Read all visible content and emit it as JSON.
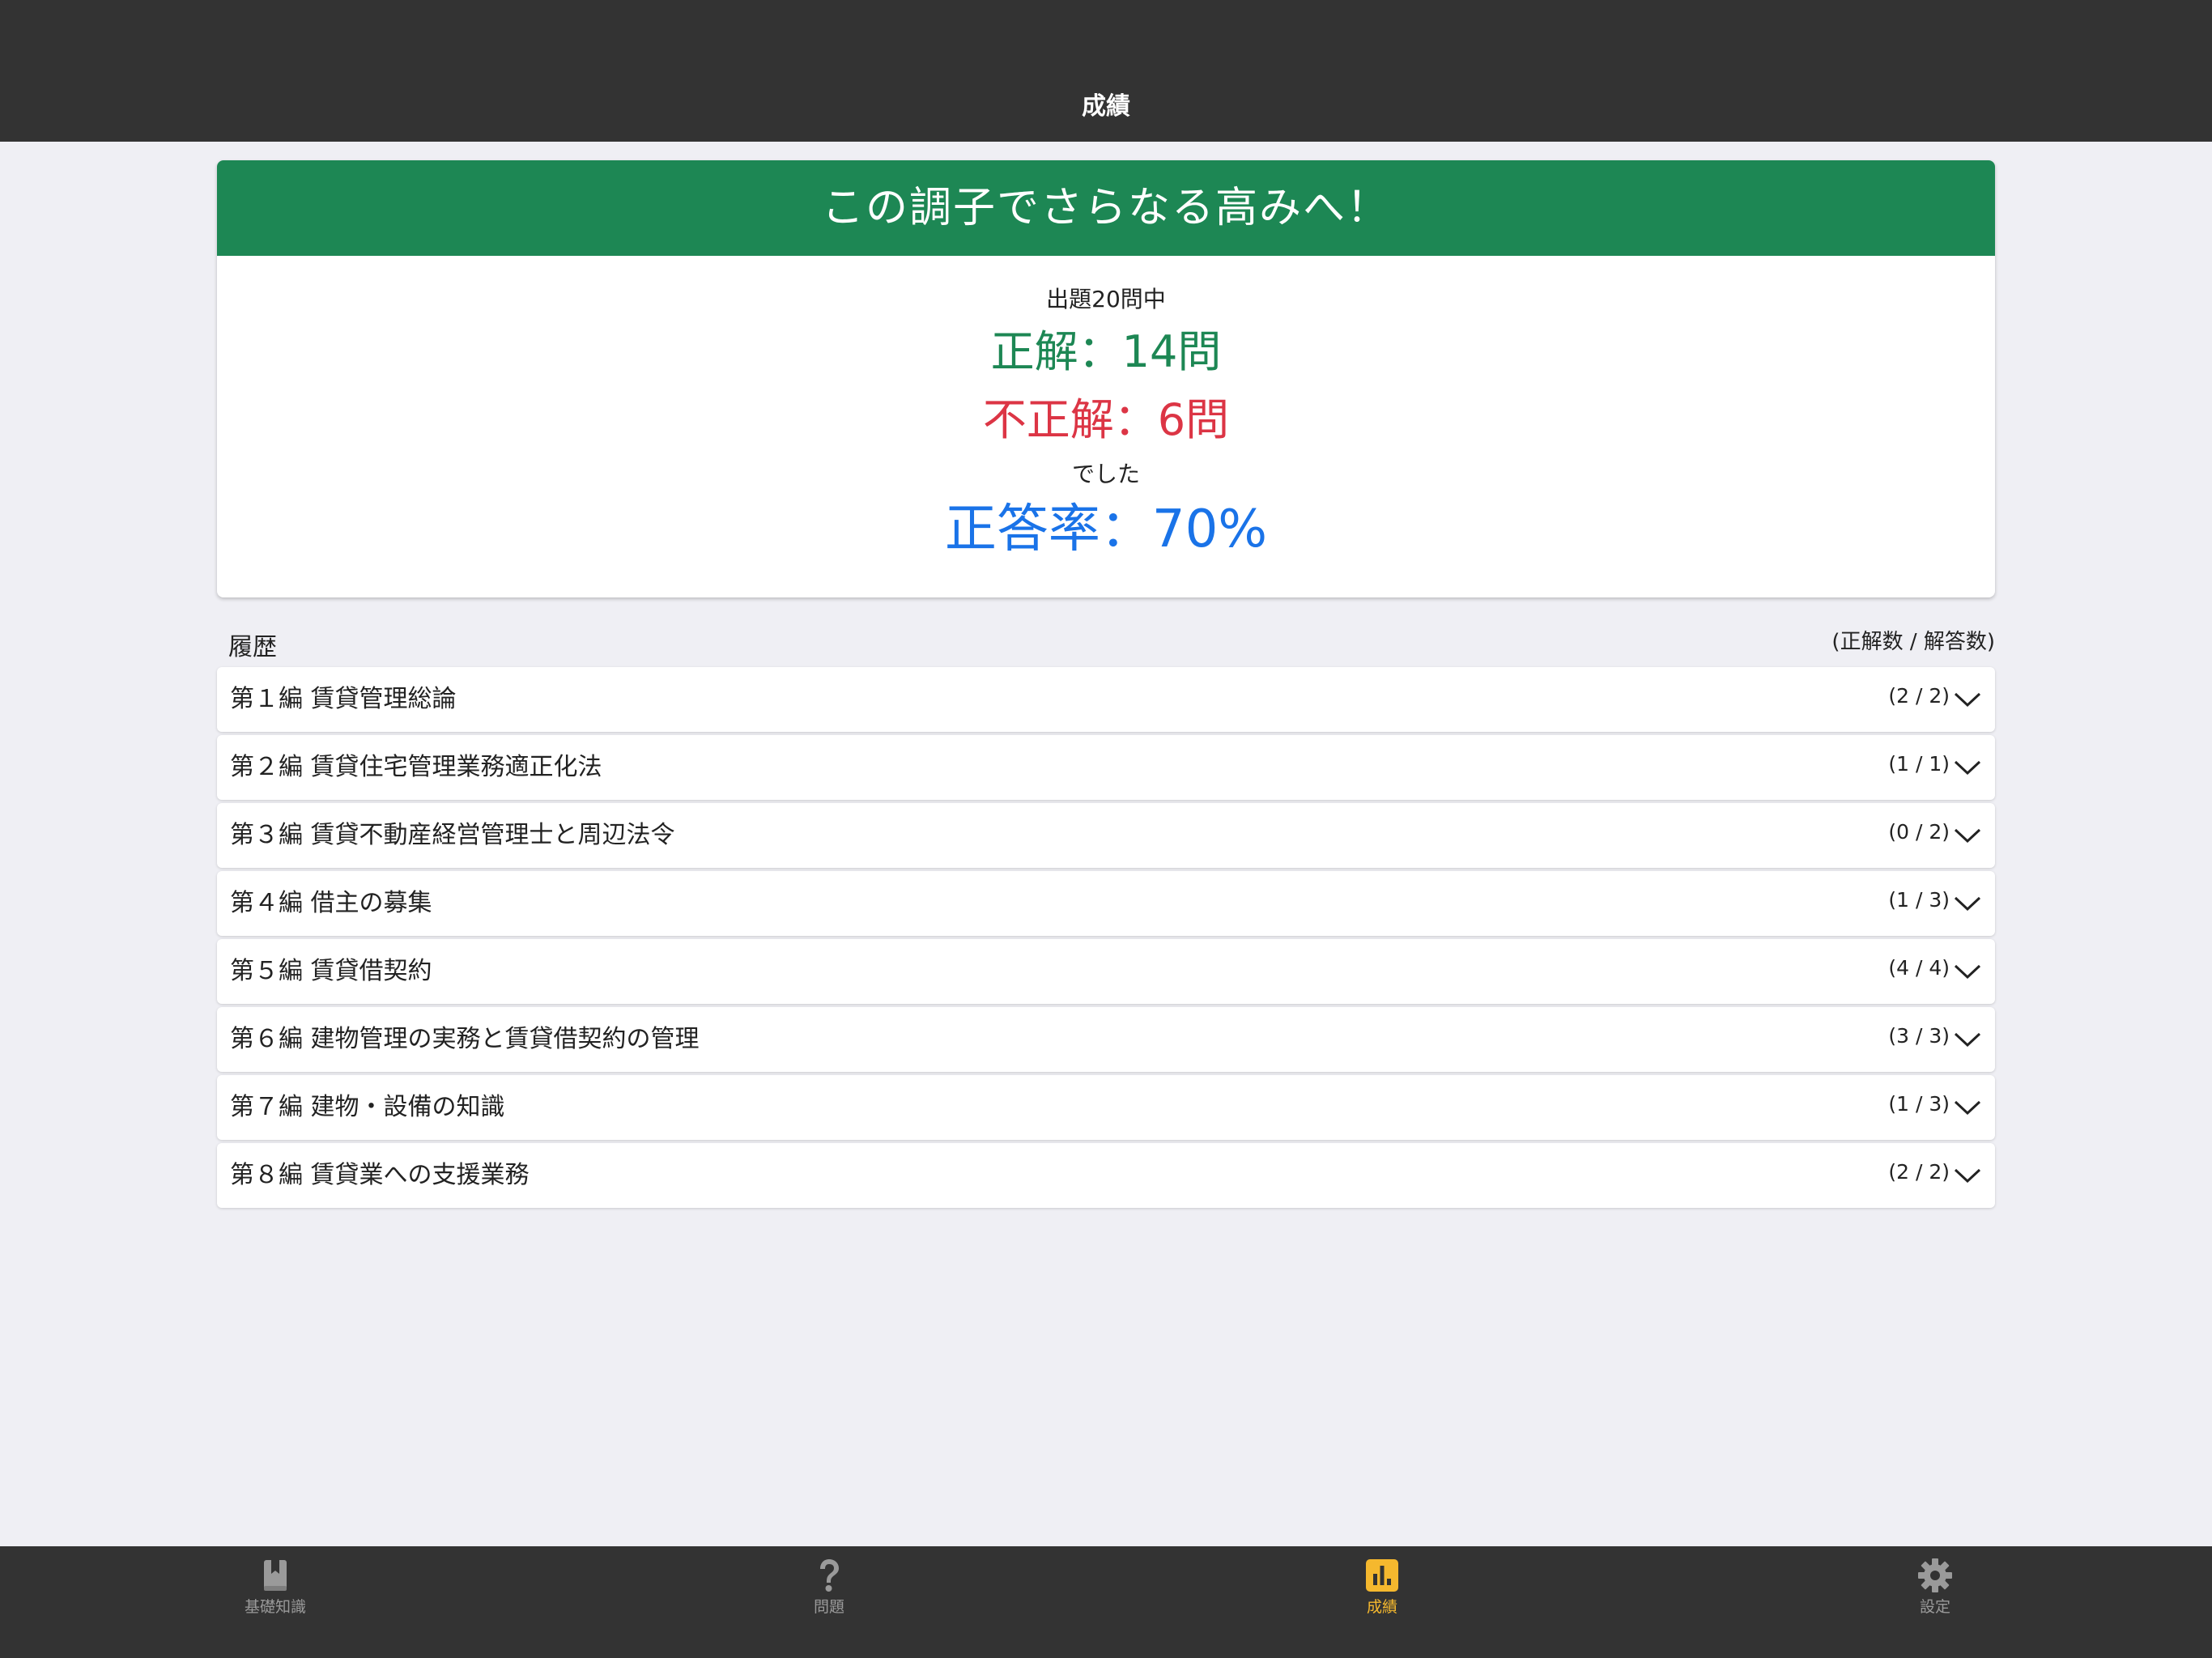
{
  "nav": {
    "title": "成績"
  },
  "result": {
    "header": "この調子でさらなる高みへ！",
    "total_line": "出題20問中",
    "correct_line": "正解：14問",
    "wrong_line": "不正解：6問",
    "deshita": "でした",
    "rate_line": "正答率：70%",
    "total_questions": 20,
    "correct_count": 14,
    "wrong_count": 6,
    "rate_percent": 70,
    "colors": {
      "header_bg": "#1d8754",
      "correct": "#1d8754",
      "wrong": "#dc3545",
      "rate": "#1a73e8"
    }
  },
  "history": {
    "label": "履歴",
    "legend": "(正解数 / 解答数)",
    "rows": [
      {
        "title": "第１編 賃貸管理総論",
        "score": "(2 / 2)",
        "correct": 2,
        "answered": 2
      },
      {
        "title": "第２編 賃貸住宅管理業務適正化法",
        "score": "(1 / 1)",
        "correct": 1,
        "answered": 1
      },
      {
        "title": "第３編 賃貸不動産経営管理士と周辺法令",
        "score": "(0 / 2)",
        "correct": 0,
        "answered": 2
      },
      {
        "title": "第４編 借主の募集",
        "score": "(1 / 3)",
        "correct": 1,
        "answered": 3
      },
      {
        "title": "第５編 賃貸借契約",
        "score": "(4 / 4)",
        "correct": 4,
        "answered": 4
      },
      {
        "title": "第６編 建物管理の実務と賃貸借契約の管理",
        "score": "(3 / 3)",
        "correct": 3,
        "answered": 3
      },
      {
        "title": "第７編 建物・設備の知識",
        "score": "(1 / 3)",
        "correct": 1,
        "answered": 3
      },
      {
        "title": "第８編 賃貸業への支援業務",
        "score": "(2 / 2)",
        "correct": 2,
        "answered": 2
      }
    ],
    "row_icon": "chevron-down-icon"
  },
  "tabs": [
    {
      "label": "基礎知識",
      "icon": "book-icon",
      "active": false
    },
    {
      "label": "問題",
      "icon": "question-mark-icon",
      "active": false
    },
    {
      "label": "成績",
      "icon": "bar-chart-icon",
      "active": true
    },
    {
      "label": "設定",
      "icon": "gear-icon",
      "active": false
    }
  ],
  "colors": {
    "bar_bg": "#333333",
    "page_bg": "#efeff4",
    "tab_active": "#f5b82e",
    "tab_inactive": "#9a9a9a"
  }
}
